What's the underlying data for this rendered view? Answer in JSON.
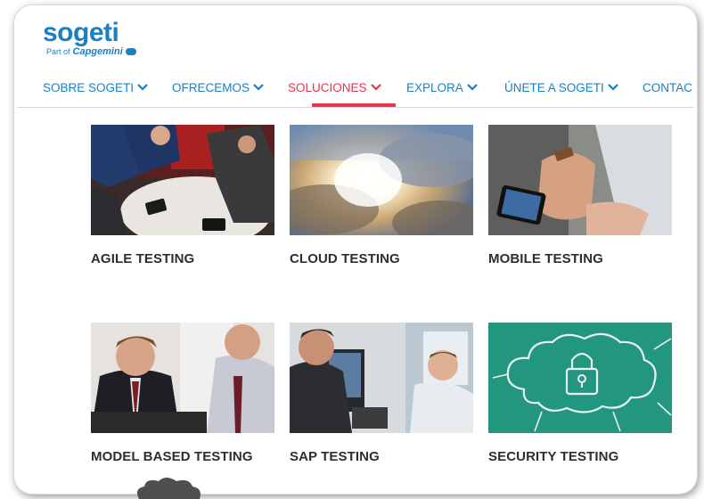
{
  "brand": {
    "name": "sogeti",
    "part_of": "Part of",
    "parent": "Capgemini"
  },
  "nav": {
    "items": [
      {
        "label": "SOBRE SOGETI",
        "has_dropdown": true,
        "active": false
      },
      {
        "label": "OFRECEMOS",
        "has_dropdown": true,
        "active": false
      },
      {
        "label": "SOLUCIONES",
        "has_dropdown": true,
        "active": true
      },
      {
        "label": "EXPLORA",
        "has_dropdown": true,
        "active": false
      },
      {
        "label": "ÚNETE A SOGETI",
        "has_dropdown": true,
        "active": false
      },
      {
        "label": "CONTAC",
        "has_dropdown": false,
        "active": false
      }
    ]
  },
  "tiles": [
    {
      "caption": "AGILE TESTING",
      "image": "business-meeting-photo"
    },
    {
      "caption": "CLOUD TESTING",
      "image": "sunlit-clouds-photo"
    },
    {
      "caption": "MOBILE TESTING",
      "image": "hand-holding-smartphone-photo"
    },
    {
      "caption": "MODEL BASED TESTING",
      "image": "two-men-laptop-photo"
    },
    {
      "caption": "SAP TESTING",
      "image": "office-colleagues-photo"
    },
    {
      "caption": "SECURITY TESTING",
      "image": "padlock-cloud-chalkboard"
    }
  ],
  "colors": {
    "brand_blue": "#1b7fc1",
    "active_red": "#e8334d",
    "caption_text": "#2e2e2e",
    "security_green": "#23967f"
  }
}
